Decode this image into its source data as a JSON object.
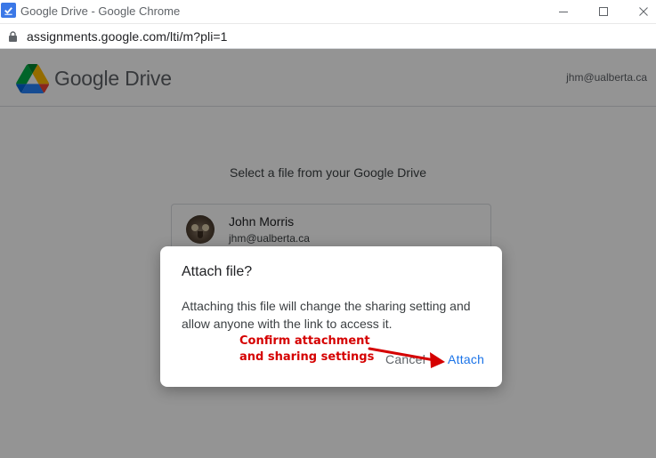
{
  "window": {
    "title": "Google Drive - Google Chrome",
    "url": "assignments.google.com/lti/m?pli=1"
  },
  "header": {
    "brand": "Google Drive",
    "user_email": "jhm@ualberta.ca"
  },
  "picker": {
    "title": "Select a file from your Google Drive",
    "account": {
      "name": "John Morris",
      "email": "jhm@ualberta.ca"
    }
  },
  "dialog": {
    "title": "Attach file?",
    "body": "Attaching this file will change the sharing setting and allow anyone with the link to access it.",
    "cancel_label": "Cancel",
    "attach_label": "Attach"
  },
  "annotation": {
    "line1": "Confirm attachment",
    "line2": "and sharing settings",
    "color": "#d50000"
  },
  "colors": {
    "accent": "#1a73e8",
    "overlay": "#000000"
  },
  "icons": {
    "app": "assignment-check-icon",
    "lock": "lock-icon",
    "logo": "google-drive-logo",
    "minimize": "minimize-icon",
    "maximize": "maximize-icon",
    "close": "close-icon"
  }
}
